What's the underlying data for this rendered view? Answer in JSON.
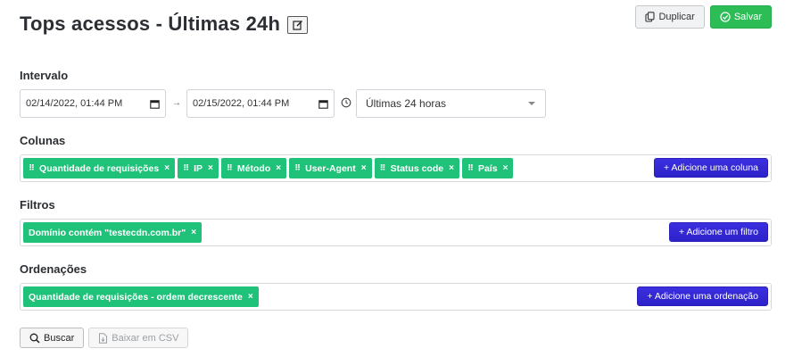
{
  "header": {
    "title": "Tops acessos - Últimas 24h",
    "duplicate_label": "Duplicar",
    "save_label": "Salvar"
  },
  "interval": {
    "label": "Intervalo",
    "start": "02/14/2022, 01:44 PM",
    "arrow": "→",
    "end": "02/15/2022, 01:44 PM",
    "range_value": "Últimas 24 horas"
  },
  "columns": {
    "label": "Colunas",
    "items": [
      {
        "label": "Quantidade de requisições"
      },
      {
        "label": "IP"
      },
      {
        "label": "Método"
      },
      {
        "label": "User-Agent"
      },
      {
        "label": "Status code"
      },
      {
        "label": "País"
      }
    ],
    "add_label": "+ Adicione uma coluna"
  },
  "filters": {
    "label": "Filtros",
    "items": [
      {
        "label": "Domínio contém \"testecdn.com.br\""
      }
    ],
    "add_label": "+ Adicione um filtro"
  },
  "orderings": {
    "label": "Ordenações",
    "items": [
      {
        "label": "Quantidade de requisições - ordem decrescente"
      }
    ],
    "add_label": "+ Adicione uma ordenação"
  },
  "footer": {
    "search_label": "Buscar",
    "csv_label": "Baixar em CSV"
  },
  "colors": {
    "chip": "#20c27a",
    "primary": "#2d22c8",
    "success": "#2dbd57"
  }
}
